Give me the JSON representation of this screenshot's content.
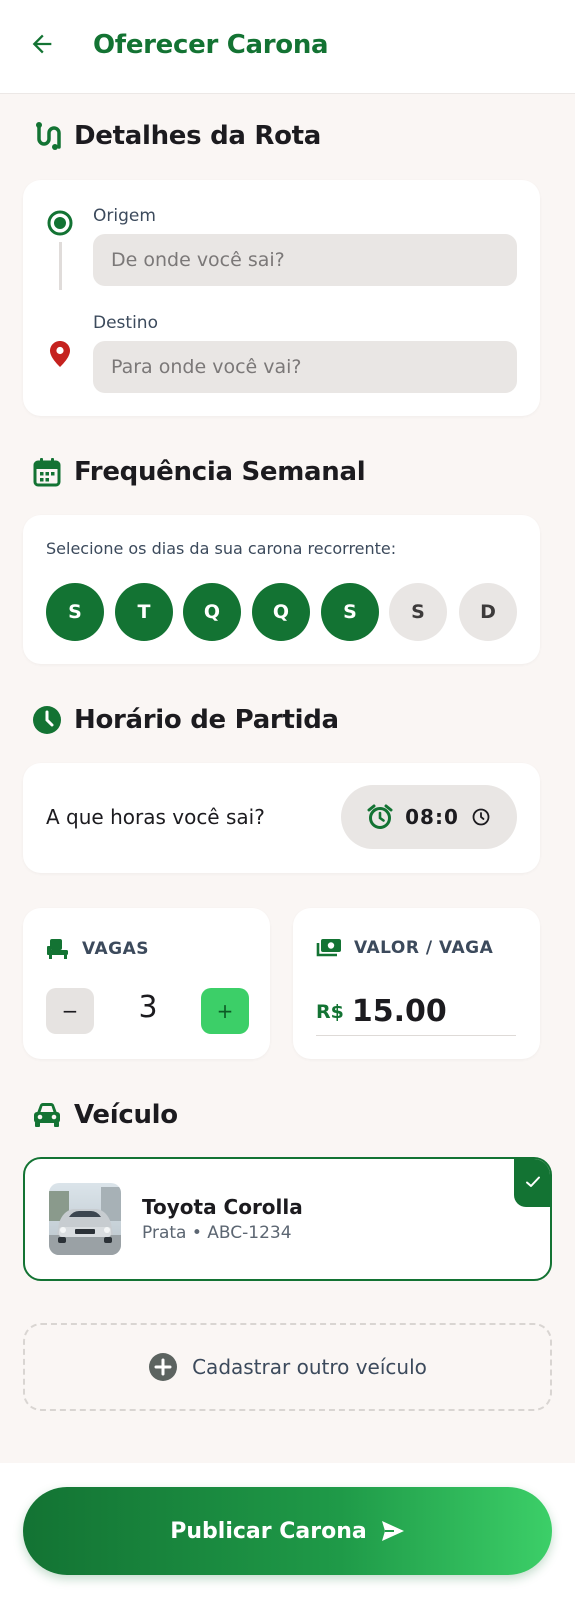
{
  "header": {
    "title": "Oferecer Carona"
  },
  "route": {
    "section_title": "Detalhes da Rota",
    "origin_label": "Origem",
    "origin_placeholder": "De onde você sai?",
    "destination_label": "Destino",
    "destination_placeholder": "Para onde você vai?"
  },
  "frequency": {
    "section_title": "Frequência Semanal",
    "caption": "Selecione os dias da sua carona recorrente:",
    "days": [
      {
        "label": "S",
        "selected": true
      },
      {
        "label": "T",
        "selected": true
      },
      {
        "label": "Q",
        "selected": true
      },
      {
        "label": "Q",
        "selected": true
      },
      {
        "label": "S",
        "selected": true
      },
      {
        "label": "S",
        "selected": false
      },
      {
        "label": "D",
        "selected": false
      }
    ]
  },
  "departure": {
    "section_title": "Horário de Partida",
    "question": "A que horas você sai?",
    "time_value": "08:0"
  },
  "seats": {
    "label": "VAGAS",
    "value": "3",
    "minus_label": "−",
    "plus_label": "+"
  },
  "price": {
    "label": "VALOR / VAGA",
    "currency": "R$",
    "value": "15.00"
  },
  "vehicle": {
    "section_title": "Veículo",
    "name": "Toyota Corolla",
    "details": "Prata • ABC-1234",
    "add_label": "Cadastrar outro veículo"
  },
  "actions": {
    "publish_label": "Publicar Carona"
  },
  "colors": {
    "primary": "#137333",
    "accent": "#3ccf68",
    "pin": "#c5221f"
  }
}
